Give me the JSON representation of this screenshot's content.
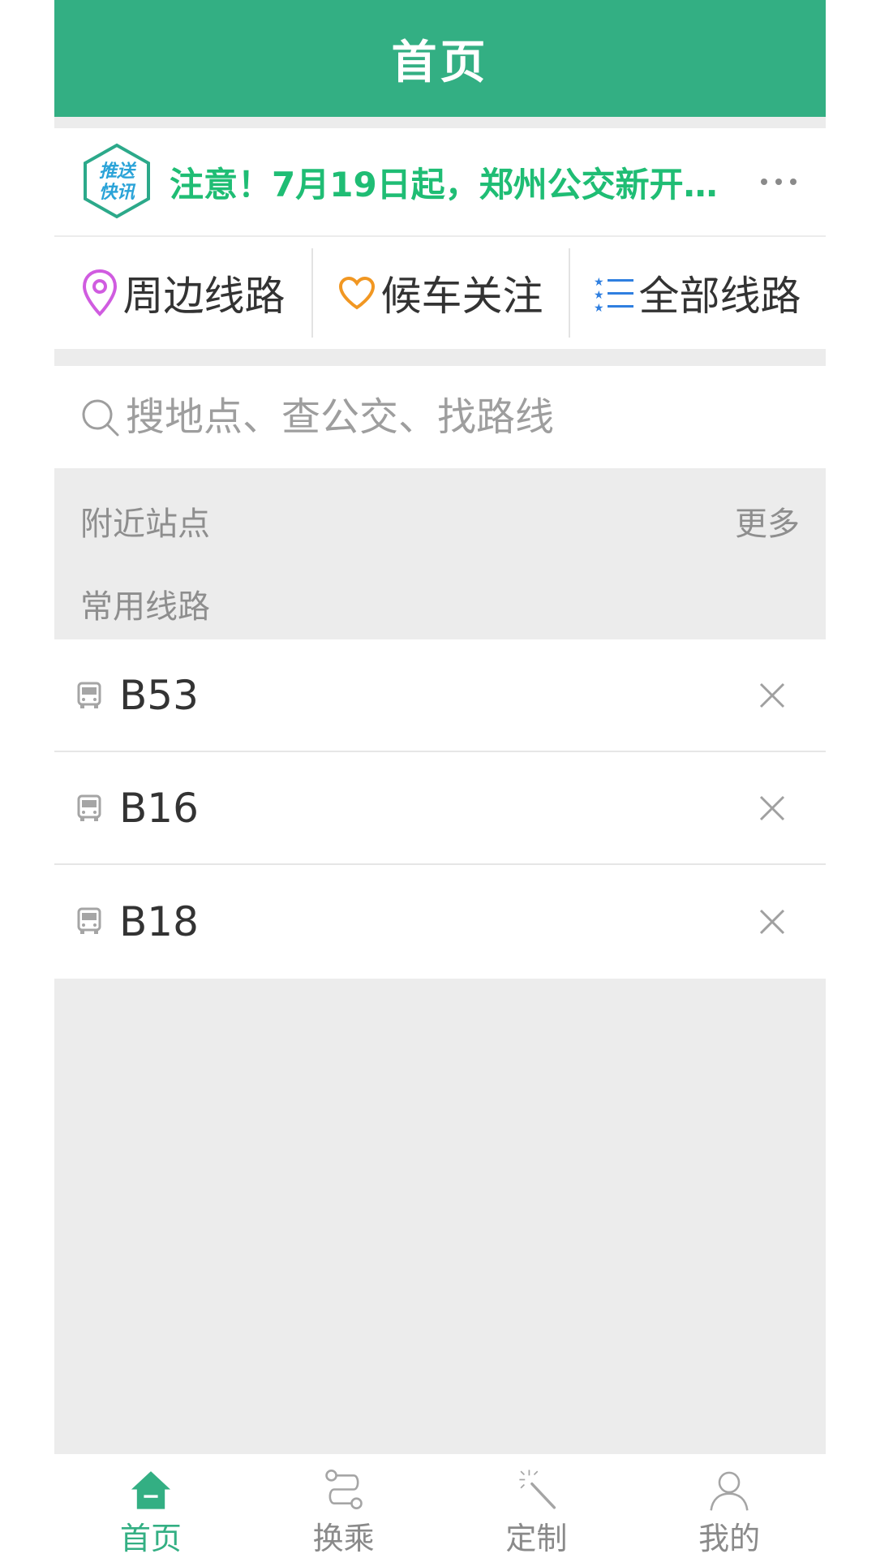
{
  "header": {
    "title": "首页"
  },
  "notice": {
    "badge_text_line1": "推送",
    "badge_text_line2": "快讯",
    "text": "注意！7月19日起，郑州公交新开…",
    "more_icon": "more-dots-icon"
  },
  "shortcuts": [
    {
      "label": "周边线路",
      "icon": "location-pin-icon",
      "color": "#d05ce0"
    },
    {
      "label": "候车关注",
      "icon": "heart-icon",
      "color": "#f19722"
    },
    {
      "label": "全部线路",
      "icon": "list-icon",
      "color": "#2f7fe0"
    }
  ],
  "search": {
    "placeholder": "搜地点、查公交、找路线"
  },
  "sections": {
    "nearby": {
      "label": "附近站点",
      "more": "更多"
    },
    "common": {
      "label": "常用线路"
    }
  },
  "routes": [
    {
      "name": "B53",
      "icon": "bus-icon"
    },
    {
      "name": "B16",
      "icon": "bus-icon"
    },
    {
      "name": "B18",
      "icon": "bus-icon"
    }
  ],
  "tabs": [
    {
      "label": "首页",
      "icon": "home-icon",
      "active": true
    },
    {
      "label": "换乘",
      "icon": "transfer-route-icon",
      "active": false
    },
    {
      "label": "定制",
      "icon": "magic-wand-icon",
      "active": false
    },
    {
      "label": "我的",
      "icon": "user-icon",
      "active": false
    }
  ],
  "colors": {
    "brand": "#33af83",
    "notice_text": "#1fbd74",
    "background": "#ececec"
  }
}
